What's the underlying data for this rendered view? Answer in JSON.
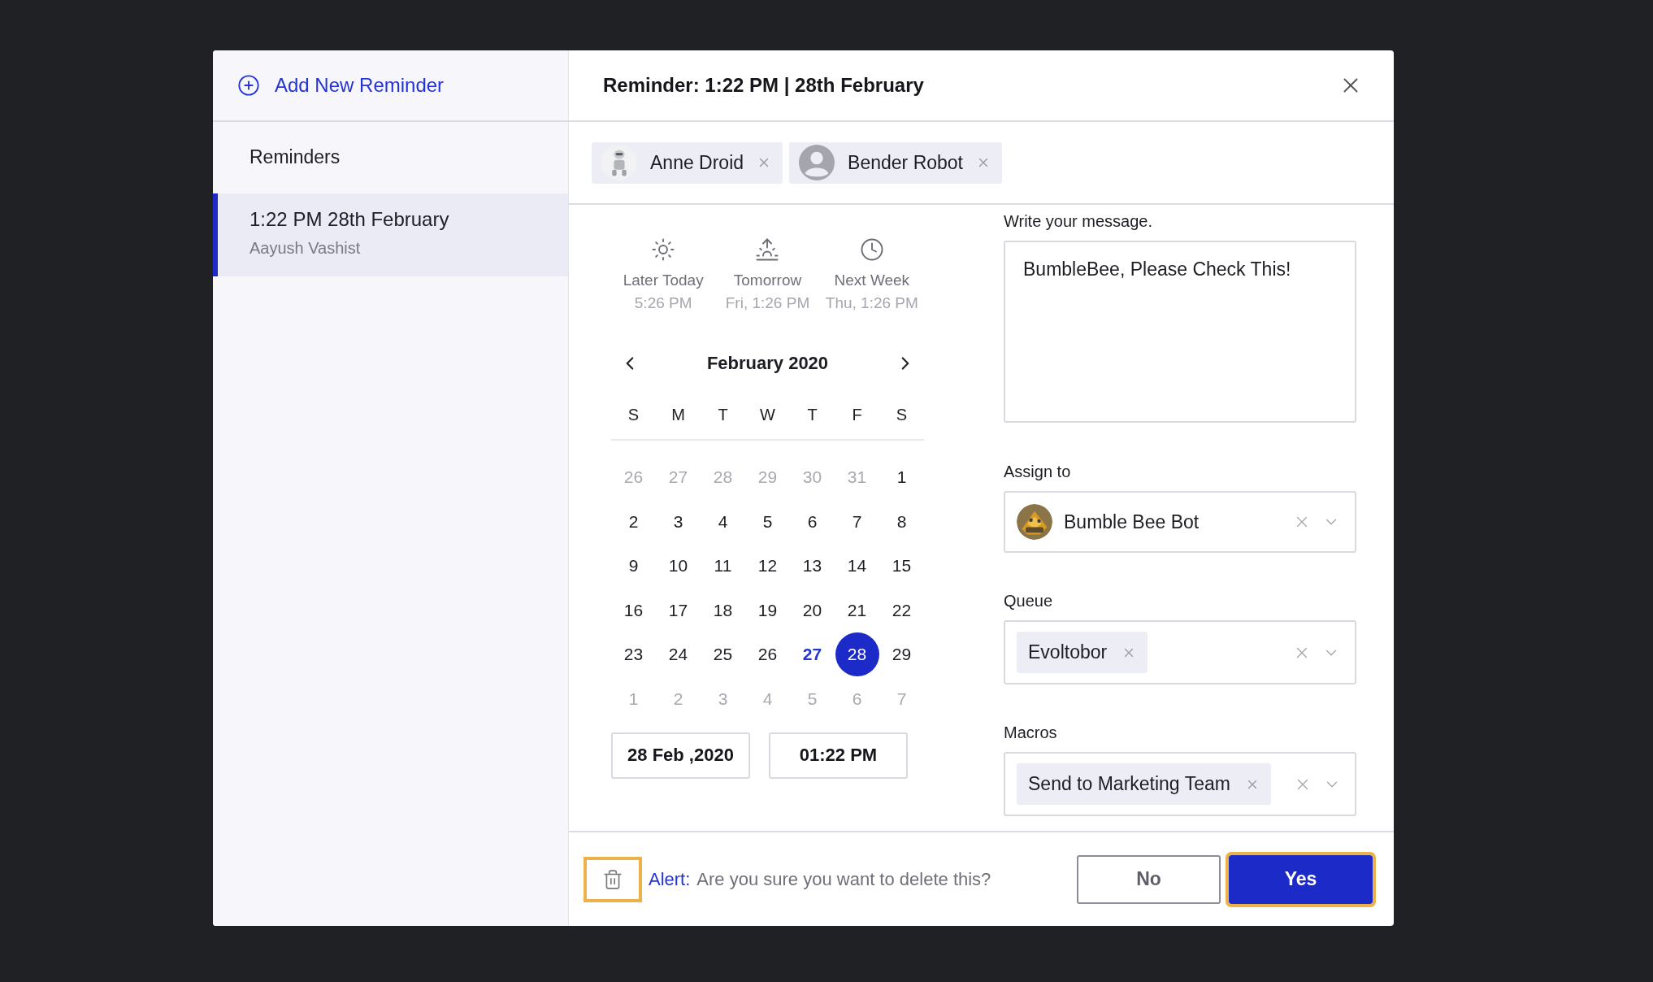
{
  "sidebar": {
    "add_button": "Add New Reminder",
    "heading": "Reminders",
    "items": [
      {
        "title": "1:22 PM 28th February",
        "subtitle": "Aayush Vashist",
        "selected": true
      }
    ]
  },
  "header": {
    "title": "Reminder: 1:22 PM | 28th February"
  },
  "recipients": [
    {
      "name": "Anne Droid"
    },
    {
      "name": "Bender Robot",
      "kind": "placeholder"
    }
  ],
  "quick_options": [
    {
      "label": "Later Today",
      "time": "5:26 PM"
    },
    {
      "label": "Tomorrow",
      "time": "Fri, 1:26 PM"
    },
    {
      "label": "Next Week",
      "time": "Thu, 1:26 PM"
    }
  ],
  "calendar": {
    "month": "February 2020",
    "weekdays": [
      "S",
      "M",
      "T",
      "W",
      "T",
      "F",
      "S"
    ],
    "weeks": [
      [
        {
          "label": "26",
          "muted": true,
          "today": false,
          "selected": false
        },
        {
          "label": "27",
          "muted": true,
          "today": false,
          "selected": false
        },
        {
          "label": "28",
          "muted": true,
          "today": false,
          "selected": false
        },
        {
          "label": "29",
          "muted": true,
          "today": false,
          "selected": false
        },
        {
          "label": "30",
          "muted": true,
          "today": false,
          "selected": false
        },
        {
          "label": "31",
          "muted": true,
          "today": false,
          "selected": false
        },
        {
          "label": "1",
          "muted": false,
          "today": false,
          "selected": false
        }
      ],
      [
        {
          "label": "2",
          "muted": false,
          "today": false,
          "selected": false
        },
        {
          "label": "3",
          "muted": false,
          "today": false,
          "selected": false
        },
        {
          "label": "4",
          "muted": false,
          "today": false,
          "selected": false
        },
        {
          "label": "5",
          "muted": false,
          "today": false,
          "selected": false
        },
        {
          "label": "6",
          "muted": false,
          "today": false,
          "selected": false
        },
        {
          "label": "7",
          "muted": false,
          "today": false,
          "selected": false
        },
        {
          "label": "8",
          "muted": false,
          "today": false,
          "selected": false
        }
      ],
      [
        {
          "label": "9",
          "muted": false,
          "today": false,
          "selected": false
        },
        {
          "label": "10",
          "muted": false,
          "today": false,
          "selected": false
        },
        {
          "label": "11",
          "muted": false,
          "today": false,
          "selected": false
        },
        {
          "label": "12",
          "muted": false,
          "today": false,
          "selected": false
        },
        {
          "label": "13",
          "muted": false,
          "today": false,
          "selected": false
        },
        {
          "label": "14",
          "muted": false,
          "today": false,
          "selected": false
        },
        {
          "label": "15",
          "muted": false,
          "today": false,
          "selected": false
        }
      ],
      [
        {
          "label": "16",
          "muted": false,
          "today": false,
          "selected": false
        },
        {
          "label": "17",
          "muted": false,
          "today": false,
          "selected": false
        },
        {
          "label": "18",
          "muted": false,
          "today": false,
          "selected": false
        },
        {
          "label": "19",
          "muted": false,
          "today": false,
          "selected": false
        },
        {
          "label": "20",
          "muted": false,
          "today": false,
          "selected": false
        },
        {
          "label": "21",
          "muted": false,
          "today": false,
          "selected": false
        },
        {
          "label": "22",
          "muted": false,
          "today": false,
          "selected": false
        }
      ],
      [
        {
          "label": "23",
          "muted": false,
          "today": false,
          "selected": false
        },
        {
          "label": "24",
          "muted": false,
          "today": false,
          "selected": false
        },
        {
          "label": "25",
          "muted": false,
          "today": false,
          "selected": false
        },
        {
          "label": "26",
          "muted": false,
          "today": false,
          "selected": false
        },
        {
          "label": "27",
          "muted": false,
          "today": true,
          "selected": false
        },
        {
          "label": "28",
          "muted": false,
          "today": false,
          "selected": true
        },
        {
          "label": "29",
          "muted": false,
          "today": false,
          "selected": false
        }
      ],
      [
        {
          "label": "1",
          "muted": true,
          "today": false,
          "selected": false
        },
        {
          "label": "2",
          "muted": true,
          "today": false,
          "selected": false
        },
        {
          "label": "3",
          "muted": true,
          "today": false,
          "selected": false
        },
        {
          "label": "4",
          "muted": true,
          "today": false,
          "selected": false
        },
        {
          "label": "5",
          "muted": true,
          "today": false,
          "selected": false
        },
        {
          "label": "6",
          "muted": true,
          "today": false,
          "selected": false
        },
        {
          "label": "7",
          "muted": true,
          "today": false,
          "selected": false
        }
      ]
    ],
    "date_value": "28 Feb ,2020",
    "time_value": "01:22 PM"
  },
  "message": {
    "label": "Write your message.",
    "value": "BumbleBee, Please Check This!"
  },
  "selects": [
    {
      "label": "Assign to",
      "kind": "person",
      "value": "Bumble Bee Bot"
    },
    {
      "label": "Queue",
      "kind": "tags",
      "tags": [
        "Evoltobor"
      ]
    },
    {
      "label": "Macros",
      "kind": "tags",
      "tags": [
        "Send to Marketing Team"
      ]
    }
  ],
  "footer": {
    "trash_focused": true,
    "alert_label": "Alert:",
    "alert_text": "Are you sure you want to delete this?",
    "buttons": [
      {
        "label": "No",
        "kind": "secondary",
        "focused": false
      },
      {
        "label": "Yes",
        "kind": "primary",
        "focused": true
      }
    ]
  }
}
